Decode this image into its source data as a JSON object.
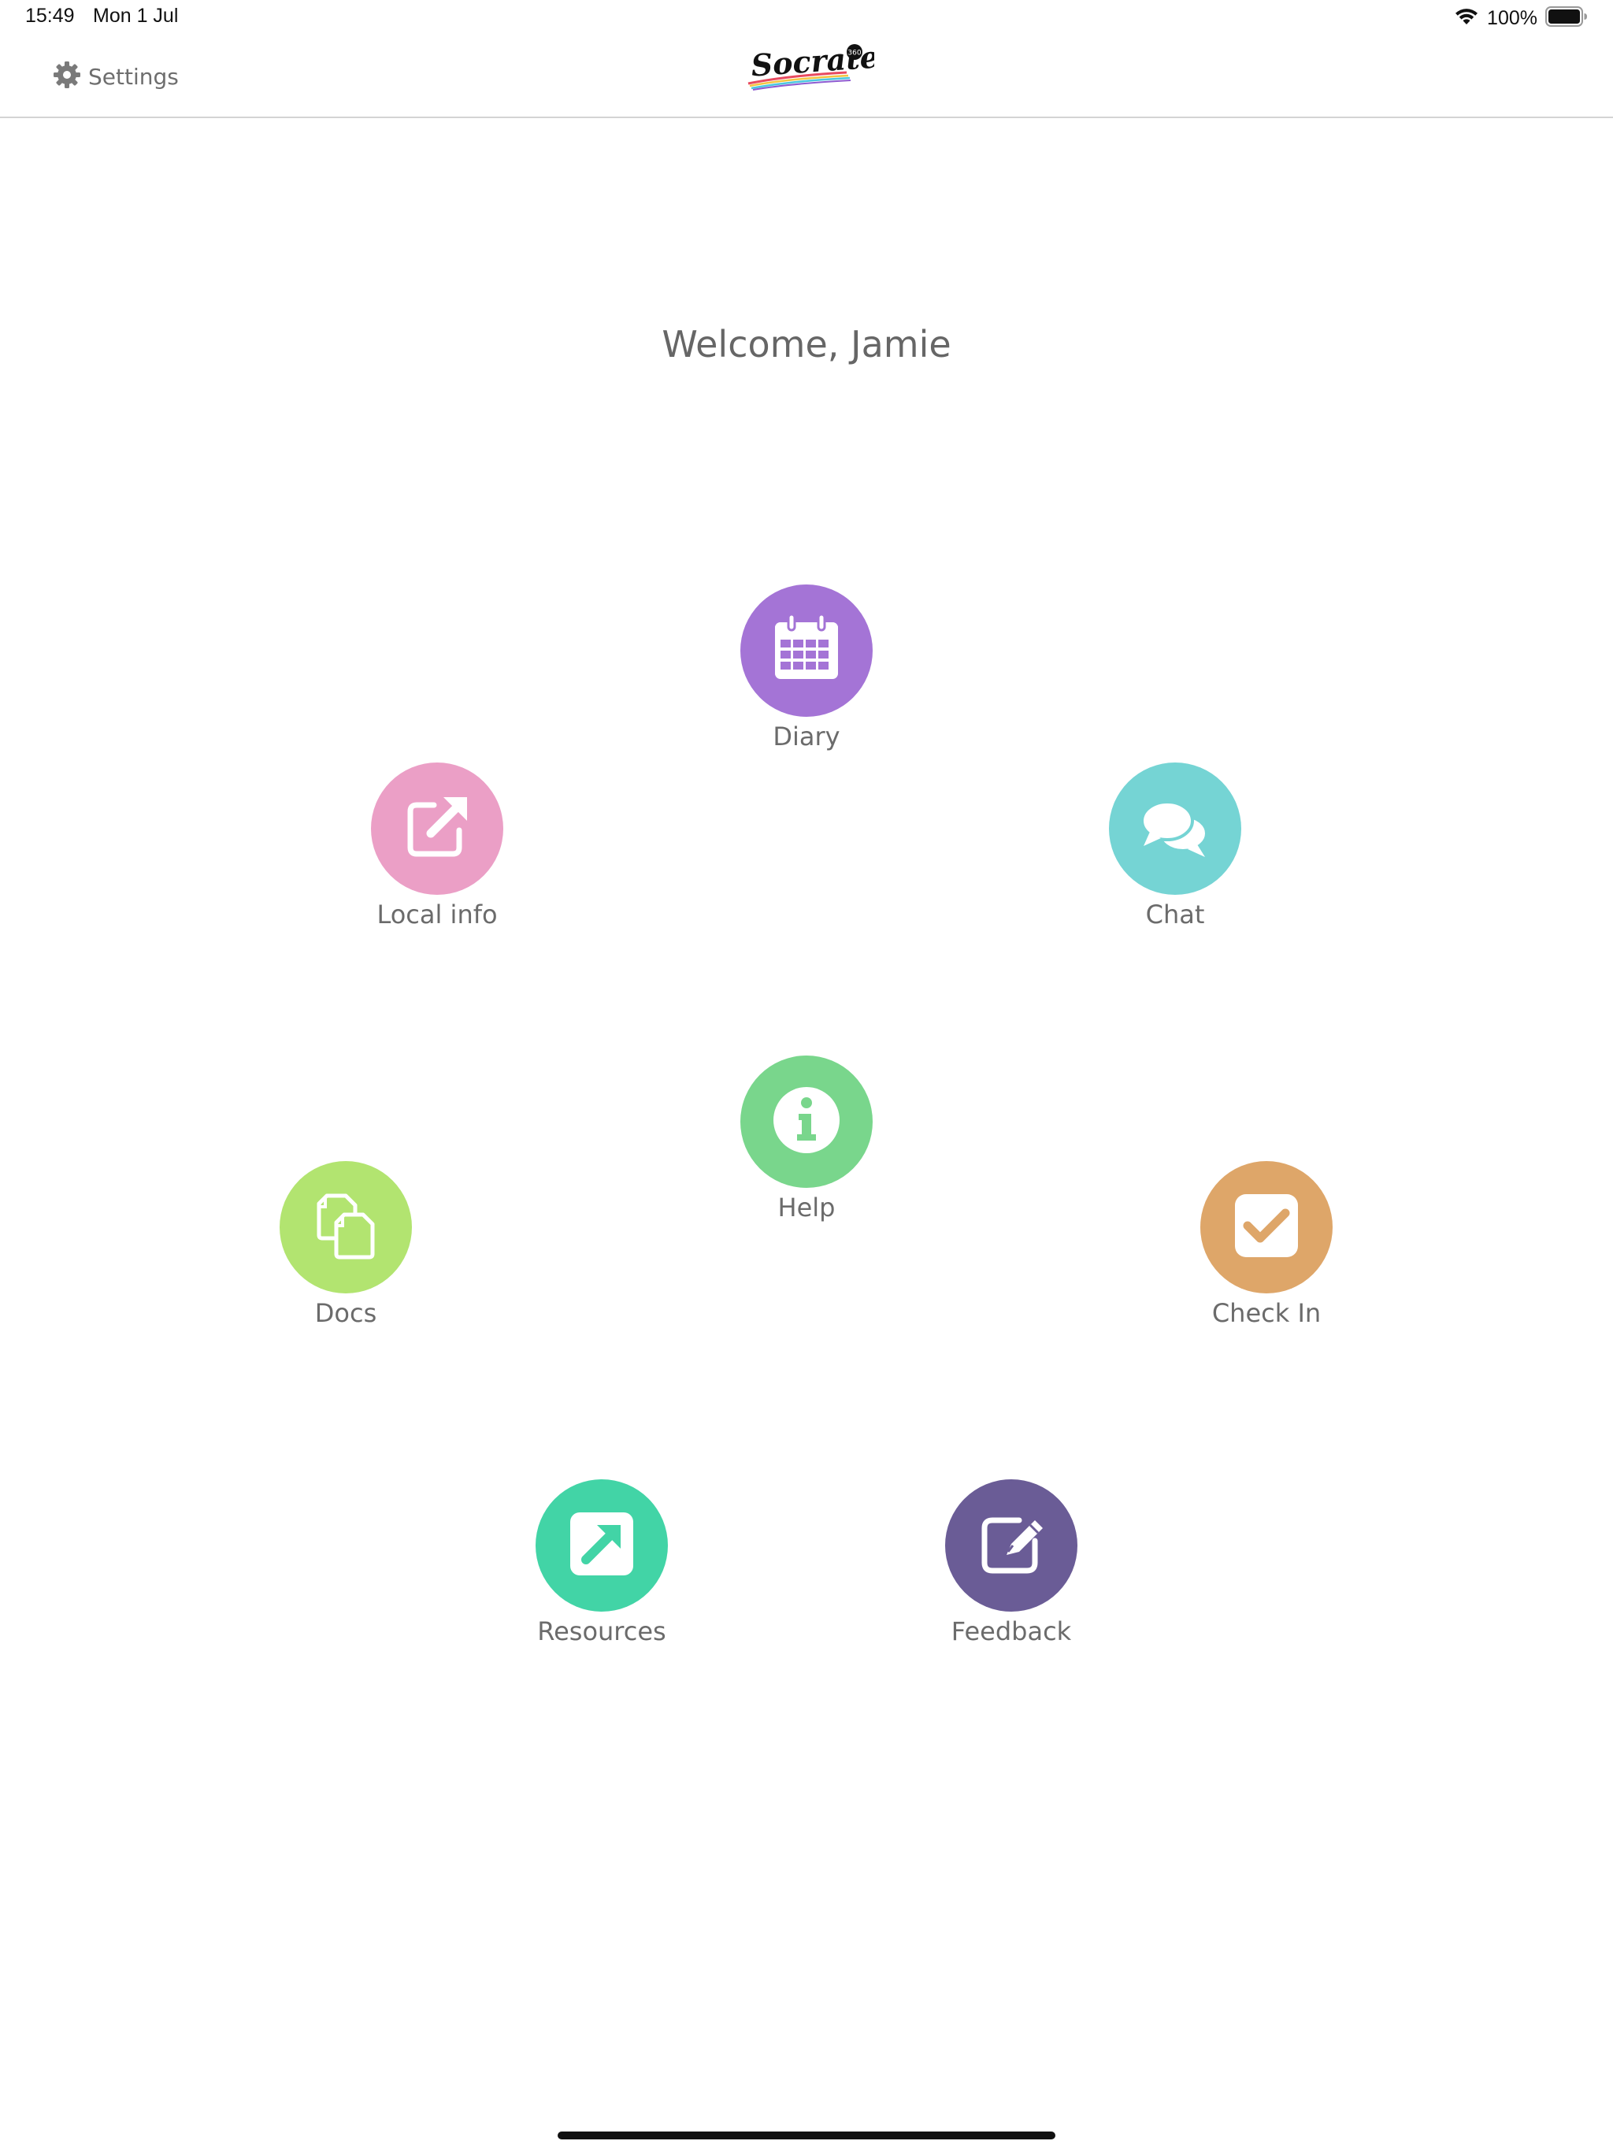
{
  "status_bar": {
    "time": "15:49",
    "date": "Mon 1 Jul",
    "battery_percent": "100%",
    "battery_level": 1.0
  },
  "nav": {
    "settings_label": "Settings",
    "logo_text": "Socrates",
    "logo_badge": "360"
  },
  "welcome": "Welcome, Jamie",
  "menu": {
    "diary": {
      "label": "Diary",
      "color": "#a474d6",
      "icon": "calendar-icon"
    },
    "local_info": {
      "label": "Local info",
      "color": "#eb9fc6",
      "icon": "external-link-icon"
    },
    "chat": {
      "label": "Chat",
      "color": "#75d4d4",
      "icon": "chat-bubbles-icon"
    },
    "help": {
      "label": "Help",
      "color": "#79d68c",
      "icon": "info-icon"
    },
    "docs": {
      "label": "Docs",
      "color": "#b2e470",
      "icon": "documents-icon"
    },
    "check_in": {
      "label": "Check In",
      "color": "#dea669",
      "icon": "checkbox-icon"
    },
    "resources": {
      "label": "Resources",
      "color": "#42d4a6",
      "icon": "arrow-up-right-icon"
    },
    "feedback": {
      "label": "Feedback",
      "color": "#6a5c96",
      "icon": "edit-icon"
    }
  }
}
